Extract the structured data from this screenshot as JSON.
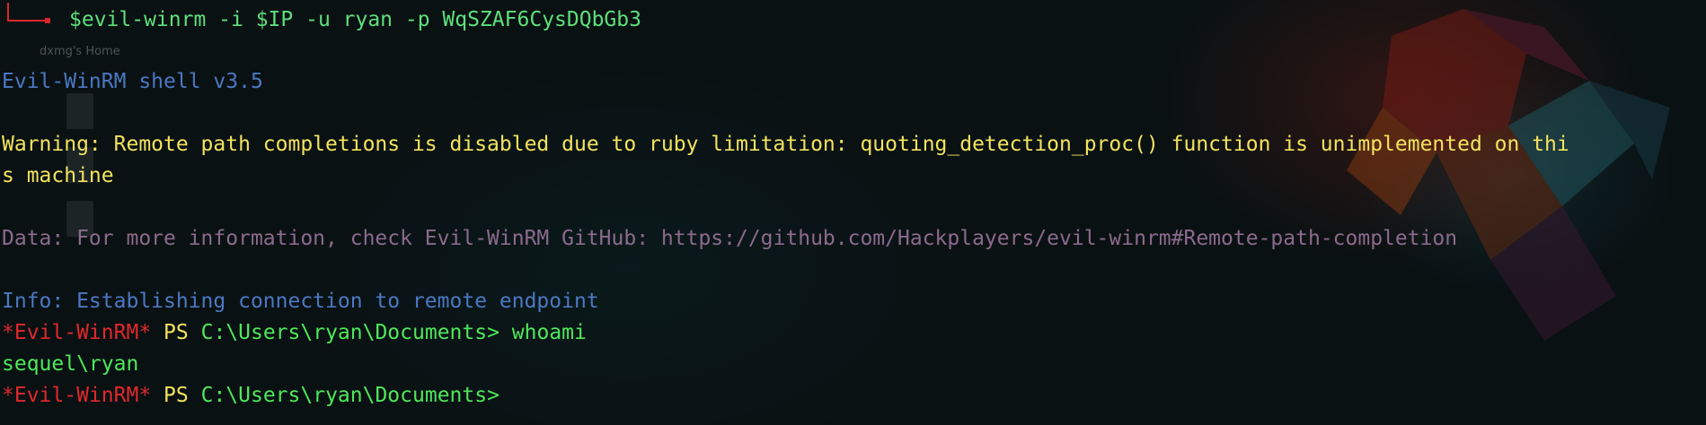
{
  "terminal": {
    "command": "$evil-winrm -i $IP -u ryan -p WqSZAF6CysDQbGb3",
    "banner": "Evil-WinRM shell v3.5",
    "warning_line1": "Warning: Remote path completions is disabled due to ruby limitation: quoting_detection_proc() function is unimplemented on thi",
    "warning_line2": "s machine",
    "data_line": "Data: For more information, check Evil-WinRM GitHub: https://github.com/Hackplayers/evil-winrm#Remote-path-completion",
    "info_line": "Info: Establishing connection to remote endpoint",
    "prompt_tag": "*Evil-WinRM*",
    "prompt_ps": "PS",
    "prompt_path": "C:\\Users\\ryan\\Documents>",
    "prompt1_command": "whoami",
    "whoami_output": "sequel\\ryan"
  },
  "desktop": {
    "home_label": "dxmg's Home"
  },
  "colors": {
    "background": "#0a1113",
    "prompt_corner": "#d8262a",
    "command": "#5ee07c",
    "info_blue": "#4a78c2",
    "warning_yellow": "#f3e35e",
    "data_purple": "#8c6a8c",
    "prompt_red": "#e0282b",
    "path_green": "#4ee85a"
  }
}
